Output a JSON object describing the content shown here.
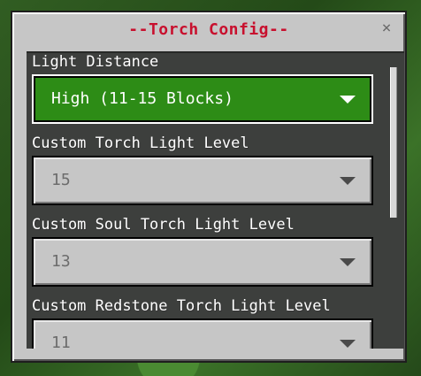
{
  "dialog": {
    "title": "--Torch Config--",
    "close_glyph": "×"
  },
  "settings": [
    {
      "label": "Light Distance",
      "value": "High (11-15 Blocks)",
      "active": true
    },
    {
      "label": "Custom Torch Light Level",
      "value": "15",
      "active": false
    },
    {
      "label": "Custom Soul Torch Light Level",
      "value": "13",
      "active": false
    },
    {
      "label": "Custom Redstone Torch Light Level",
      "value": "11",
      "active": false
    }
  ],
  "colors": {
    "title": "#c8102e",
    "active_dropdown": "#2d8c16",
    "panel": "#3d3f3d",
    "dialog": "#c6c6c6"
  },
  "icons": {
    "close": "close-icon",
    "dropdown_arrow": "chevron-down-icon"
  }
}
